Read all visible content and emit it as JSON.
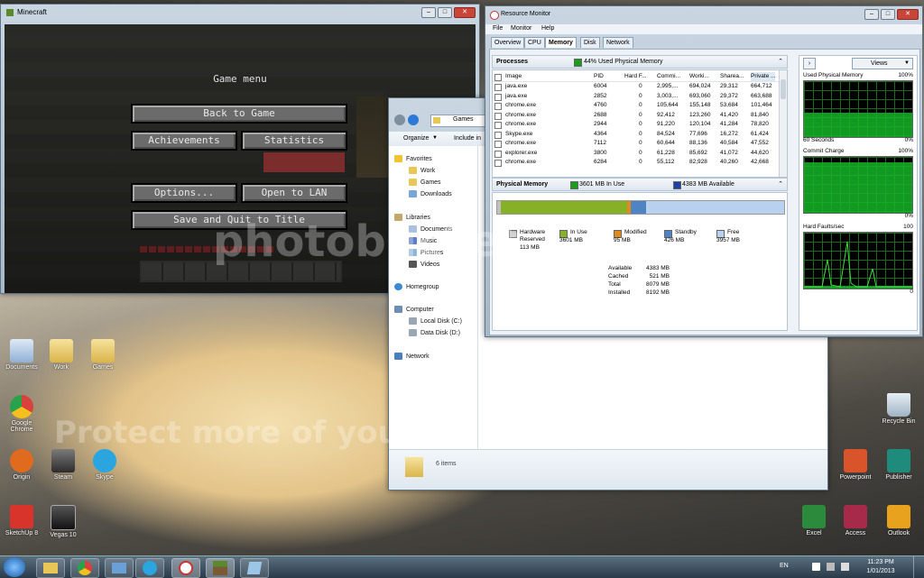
{
  "minecraft": {
    "window_title": "Minecraft",
    "menu_title": "Game menu",
    "buttons": {
      "back": "Back to Game",
      "achievements": "Achievements",
      "statistics": "Statistics",
      "options": "Options...",
      "lan": "Open to LAN",
      "save_quit": "Save and Quit to Title"
    }
  },
  "explorer": {
    "address": "Games",
    "toolbar": {
      "organize": "Organize",
      "include": "Include in"
    },
    "favorites_label": "Favorites",
    "favorites": [
      "Work",
      "Games",
      "Downloads"
    ],
    "libraries_label": "Libraries",
    "libraries": [
      "Documents",
      "Music",
      "Pictures",
      "Videos"
    ],
    "homegroup": "Homegroup",
    "computer_label": "Computer",
    "drives": [
      "Local Disk (C:)",
      "Data Disk (D:)"
    ],
    "network": "Network",
    "status": "6 items"
  },
  "resmon": {
    "window_title": "Resource Monitor",
    "menu": [
      "File",
      "Monitor",
      "Help"
    ],
    "tabs": [
      "Overview",
      "CPU",
      "Memory",
      "Disk",
      "Network"
    ],
    "processes": {
      "label": "Processes",
      "summary": "44% Used Physical Memory",
      "columns": [
        "Image",
        "PID",
        "Hard F...",
        "Commi...",
        "Worki...",
        "Sharea...",
        "Private ..."
      ],
      "rows": [
        [
          "java.exe",
          "6004",
          "0",
          "2,995,...",
          "694,024",
          "29,312",
          "664,712"
        ],
        [
          "java.exe",
          "2852",
          "0",
          "3,003,...",
          "693,060",
          "29,372",
          "663,688"
        ],
        [
          "chrome.exe",
          "4760",
          "0",
          "105,644",
          "155,148",
          "53,684",
          "101,464"
        ],
        [
          "chrome.exe",
          "2688",
          "0",
          "92,412",
          "123,260",
          "41,420",
          "81,840"
        ],
        [
          "chrome.exe",
          "2944",
          "0",
          "91,220",
          "120,104",
          "41,284",
          "78,820"
        ],
        [
          "Skype.exe",
          "4364",
          "0",
          "84,524",
          "77,696",
          "16,272",
          "61,424"
        ],
        [
          "chrome.exe",
          "7112",
          "0",
          "60,644",
          "88,136",
          "40,584",
          "47,552"
        ],
        [
          "explorer.exe",
          "3800",
          "0",
          "61,228",
          "85,692",
          "41,072",
          "44,620"
        ],
        [
          "chrome.exe",
          "6284",
          "0",
          "55,112",
          "82,928",
          "40,260",
          "42,668"
        ]
      ]
    },
    "physical": {
      "label": "Physical Memory",
      "in_use_summary": "3601 MB In Use",
      "available_summary": "4383 MB Available",
      "usage_fractions": {
        "reserved": 0.014,
        "in_use": 0.44,
        "modified": 0.012,
        "standby": 0.052,
        "free": 0.482
      },
      "legend": [
        {
          "label": "Hardware Reserved",
          "value": "113 MB",
          "color": "#c0c0c0"
        },
        {
          "label": "In Use",
          "value": "3601 MB",
          "color": "#86b126"
        },
        {
          "label": "Modified",
          "value": "95 MB",
          "color": "#e08a1e"
        },
        {
          "label": "Standby",
          "value": "426 MB",
          "color": "#4f84c4"
        },
        {
          "label": "Free",
          "value": "3957 MB",
          "color": "#b7d1ee"
        }
      ],
      "stats": [
        {
          "label": "Available",
          "value": "4383 MB"
        },
        {
          "label": "Cached",
          "value": "521 MB"
        },
        {
          "label": "Total",
          "value": "8079 MB"
        },
        {
          "label": "Installed",
          "value": "8192 MB"
        }
      ]
    },
    "views_label": "Views",
    "graphs": [
      {
        "title": "Used Physical Memory",
        "max": "100%",
        "footer_left": "60 Seconds",
        "footer_right": "0%",
        "level": 0.44
      },
      {
        "title": "Commit Charge",
        "max": "100%",
        "footer_left": "",
        "footer_right": "0%",
        "level": 0.9
      },
      {
        "title": "Hard Faults/sec",
        "max": "100",
        "footer_left": "",
        "footer_right": "0",
        "level": 0.05
      }
    ]
  },
  "desktop_icons": {
    "documents": "Documents",
    "work": "Work",
    "games": "Games",
    "chrome": "Google Chrome",
    "origin": "Origin",
    "steam": "Steam",
    "skype": "Skype",
    "sketchup": "SketchUp 8",
    "vegas": "Vegas 10",
    "recycle": "Recycle Bin",
    "powerpoint": "Powerpoint",
    "publisher": "Publisher",
    "excel": "Excel",
    "access": "Access",
    "outlook": "Outlook"
  },
  "taskbar": {
    "time": "11:23 PM",
    "date": "1/01/2013",
    "lang": "EN"
  },
  "watermark": {
    "logo": "photobucket",
    "tagline": "Protect more of your memories for less!"
  }
}
